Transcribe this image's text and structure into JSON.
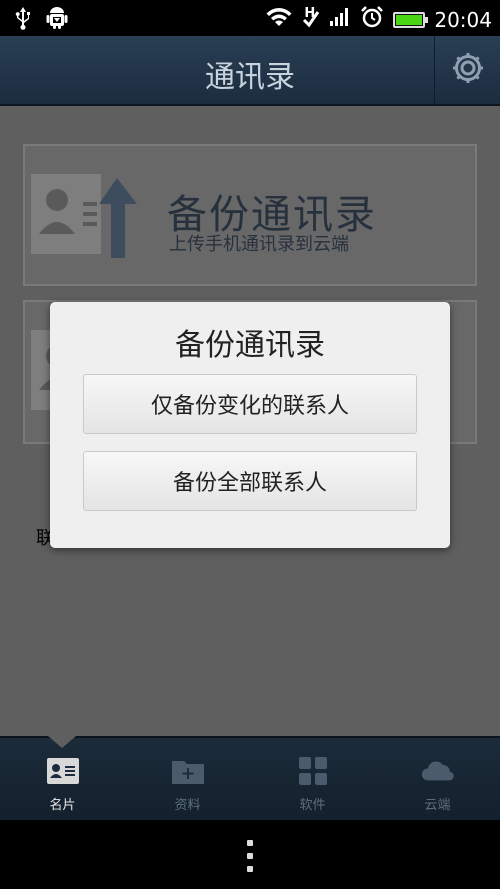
{
  "status": {
    "icons_left": [
      "usb-icon",
      "android-debug-icon"
    ],
    "icons_right": [
      "wifi-icon",
      "network-h-icon",
      "signal-icon",
      "alarm-icon",
      "battery-icon"
    ],
    "network_type": "H",
    "battery_level": 1.0,
    "time": "20:04"
  },
  "header": {
    "title": "通讯录",
    "settings_icon": "gear-icon"
  },
  "main": {
    "backup_card": {
      "title": "备份通讯录",
      "subtitle": "上传手机通讯录到云端"
    },
    "peek_text": "联"
  },
  "dialog": {
    "title": "备份通讯录",
    "options": [
      {
        "label": "仅备份变化的联系人"
      },
      {
        "label": "备份全部联系人"
      }
    ]
  },
  "tabbar": {
    "tabs": [
      {
        "label": "名片",
        "icon": "contact-card-icon",
        "active": true
      },
      {
        "label": "资料",
        "icon": "folder-add-icon",
        "active": false
      },
      {
        "label": "软件",
        "icon": "apps-grid-icon",
        "active": false
      },
      {
        "label": "云端",
        "icon": "cloud-icon",
        "active": false
      }
    ]
  },
  "colors": {
    "titlebar": "#1b2c3e",
    "dim_overlay": "#5f5f5f",
    "dialog_bg": "#efefef",
    "battery_fill": "#49d414"
  }
}
